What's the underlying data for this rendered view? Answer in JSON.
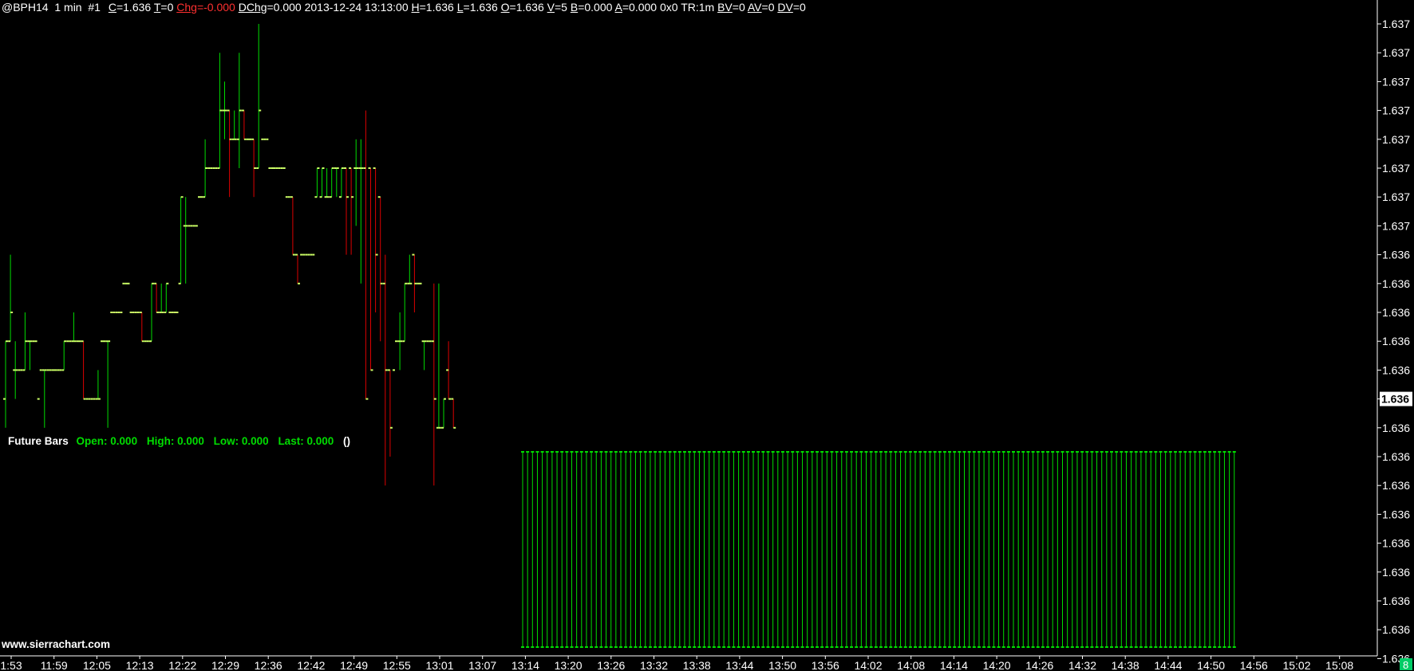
{
  "header": {
    "symbol": "@BPH14",
    "interval": "1 min",
    "chart_no": "#1",
    "fields": [
      {
        "key": "C",
        "value": "=1.636",
        "neg": false
      },
      {
        "key": "T",
        "value": "=0",
        "neg": false
      },
      {
        "key": "Chg",
        "value": "=-0.000",
        "neg": true
      },
      {
        "key": "DChg",
        "value": "=0.000",
        "neg": false
      }
    ],
    "datetime": "2013-12-24 13:13:00",
    "fields2": [
      {
        "key": "H",
        "value": "=1.636"
      },
      {
        "key": "L",
        "value": "=1.636"
      },
      {
        "key": "O",
        "value": "=1.636"
      },
      {
        "key": "V",
        "value": "=5"
      },
      {
        "key": "B",
        "value": "=0.000"
      },
      {
        "key": "A",
        "value": "=0.000"
      }
    ],
    "bidask_size": "0x0",
    "tr": "TR:1m",
    "fields3": [
      {
        "key": "BV",
        "value": "=0"
      },
      {
        "key": "AV",
        "value": "=0"
      },
      {
        "key": "DV",
        "value": "=0"
      }
    ]
  },
  "future_bars": {
    "label": "Future Bars",
    "open": "Open: 0.000",
    "high": "High: 0.000",
    "low": "Low: 0.000",
    "last": "Last: 0.000",
    "extra": "()"
  },
  "watermark": "www.sierrachart.com",
  "page_badge": "8",
  "colors": {
    "background": "#000000",
    "up": "#00dd00",
    "down": "#dd0000",
    "tick": "#ccff66",
    "axis_text": "#ffffff",
    "badge": "#00cc66"
  },
  "chart_data": {
    "type": "bar",
    "y_tick_labels": [
      "1.637",
      "1.637",
      "1.637",
      "1.637",
      "1.637",
      "1.637",
      "1.637",
      "1.637",
      "1.636",
      "1.636",
      "1.636",
      "1.636",
      "1.636",
      "1.636",
      "1.636",
      "1.636",
      "1.636",
      "1.636",
      "1.636",
      "1.636",
      "1.636",
      "1.636",
      "1.636"
    ],
    "current_price": "1.636",
    "x_tick_labels": [
      "1:53",
      "11:59",
      "12:05",
      "12:13",
      "12:22",
      "12:29",
      "12:36",
      "12:42",
      "12:49",
      "12:55",
      "13:01",
      "13:07",
      "13:14",
      "13:20",
      "13:26",
      "13:32",
      "13:38",
      "13:44",
      "13:50",
      "13:56",
      "14:02",
      "14:08",
      "14:14",
      "14:20",
      "14:26",
      "14:32",
      "14:38",
      "14:44",
      "14:50",
      "14:56",
      "15:02",
      "15:08"
    ],
    "price_levels_ticks": [
      26,
      25,
      24,
      23,
      22,
      21,
      20,
      19,
      18,
      17,
      16,
      15,
      14,
      13,
      12
    ],
    "bars": [
      {
        "o": 14,
        "h": 16,
        "l": 13,
        "c": 16
      },
      {
        "o": 16,
        "h": 19,
        "l": 16,
        "c": 17
      },
      {
        "o": 15,
        "h": 16,
        "l": 14,
        "c": 15
      },
      {
        "o": 15,
        "h": 15,
        "l": 15,
        "c": 15
      },
      {
        "o": 15,
        "h": 17,
        "l": 15,
        "c": 16
      },
      {
        "o": 16,
        "h": 16,
        "l": 15,
        "c": 16
      },
      {
        "o": 16,
        "h": 16,
        "l": 16,
        "c": 16
      },
      {
        "o": 14,
        "h": 14,
        "l": 14,
        "c": 15
      },
      {
        "o": 15,
        "h": 15,
        "l": 13,
        "c": 15
      },
      {
        "o": 15,
        "h": 15,
        "l": 15,
        "c": 15
      },
      {
        "o": 15,
        "h": 15,
        "l": 15,
        "c": 15
      },
      {
        "o": 15,
        "h": 15,
        "l": 15,
        "c": 15
      },
      {
        "o": 15,
        "h": 16,
        "l": 15,
        "c": 16
      },
      {
        "o": 16,
        "h": 16,
        "l": 16,
        "c": 16
      },
      {
        "o": 16,
        "h": 17,
        "l": 16,
        "c": 16
      },
      {
        "o": 16,
        "h": 16,
        "l": 16,
        "c": 16
      },
      {
        "o": 16,
        "h": 16,
        "l": 14,
        "c": 14
      },
      {
        "o": 14,
        "h": 14,
        "l": 14,
        "c": 14
      },
      {
        "o": 14,
        "h": 14,
        "l": 14,
        "c": 14
      },
      {
        "o": 14,
        "h": 15,
        "l": 14,
        "c": 14
      },
      {
        "o": 16,
        "h": 16,
        "l": 16,
        "c": 16
      },
      {
        "o": 16,
        "h": 16,
        "l": 13,
        "c": 16
      },
      {
        "o": 17,
        "h": 17,
        "l": 17,
        "c": 17
      },
      {
        "o": 17,
        "h": 17,
        "l": 17,
        "c": 17
      },
      {
        "o": 17,
        "h": 17,
        "l": 17,
        "c": 18
      },
      {
        "o": 18,
        "h": 18,
        "l": 18,
        "c": 18
      },
      {
        "o": 17,
        "h": 17,
        "l": 17,
        "c": 17
      },
      {
        "o": 17,
        "h": 17,
        "l": 17,
        "c": 17
      },
      {
        "o": 17,
        "h": 17,
        "l": 16,
        "c": 16
      },
      {
        "o": 16,
        "h": 16,
        "l": 16,
        "c": 16
      },
      {
        "o": 16,
        "h": 18,
        "l": 16,
        "c": 18
      },
      {
        "o": 18,
        "h": 18,
        "l": 17,
        "c": 17
      },
      {
        "o": 17,
        "h": 18,
        "l": 17,
        "c": 17
      },
      {
        "o": 17,
        "h": 18,
        "l": 17,
        "c": 18
      },
      {
        "o": 17,
        "h": 17,
        "l": 17,
        "c": 17
      },
      {
        "o": 17,
        "h": 17,
        "l": 17,
        "c": 17
      },
      {
        "o": 18,
        "h": 21,
        "l": 18,
        "c": 21
      },
      {
        "o": 20,
        "h": 21,
        "l": 18,
        "c": 20
      },
      {
        "o": 20,
        "h": 20,
        "l": 20,
        "c": 20
      },
      {
        "o": 20,
        "h": 20,
        "l": 20,
        "c": 20
      },
      {
        "o": 21,
        "h": 21,
        "l": 21,
        "c": 21
      },
      {
        "o": 21,
        "h": 23,
        "l": 21,
        "c": 22
      },
      {
        "o": 22,
        "h": 22,
        "l": 22,
        "c": 22
      },
      {
        "o": 22,
        "h": 22,
        "l": 22,
        "c": 22
      },
      {
        "o": 22,
        "h": 26,
        "l": 22,
        "c": 24
      },
      {
        "o": 24,
        "h": 25,
        "l": 23,
        "c": 24
      },
      {
        "o": 24,
        "h": 24,
        "l": 21,
        "c": 23
      },
      {
        "o": 23,
        "h": 24,
        "l": 23,
        "c": 23
      },
      {
        "o": 23,
        "h": 26,
        "l": 22,
        "c": 24
      },
      {
        "o": 24,
        "h": 24,
        "l": 23,
        "c": 23
      },
      {
        "o": 23,
        "h": 23,
        "l": 23,
        "c": 23
      },
      {
        "o": 23,
        "h": 23,
        "l": 21,
        "c": 22
      },
      {
        "o": 22,
        "h": 27,
        "l": 22,
        "c": 24
      },
      {
        "o": 23,
        "h": 23,
        "l": 23,
        "c": 23
      },
      {
        "o": 23,
        "h": 23,
        "l": 23,
        "c": 22
      },
      {
        "o": 22,
        "h": 22,
        "l": 22,
        "c": 22
      },
      {
        "o": 22,
        "h": 22,
        "l": 22,
        "c": 22
      },
      {
        "o": 22,
        "h": 22,
        "l": 22,
        "c": 22
      },
      {
        "o": 21,
        "h": 21,
        "l": 21,
        "c": 21
      },
      {
        "o": 21,
        "h": 21,
        "l": 19,
        "c": 19
      },
      {
        "o": 19,
        "h": 19,
        "l": 18,
        "c": 18
      },
      {
        "o": 19,
        "h": 19,
        "l": 19,
        "c": 19
      },
      {
        "o": 19,
        "h": 19,
        "l": 19,
        "c": 19
      },
      {
        "o": 19,
        "h": 19,
        "l": 19,
        "c": 19
      },
      {
        "o": 21,
        "h": 22,
        "l": 21,
        "c": 22
      },
      {
        "o": 21,
        "h": 22,
        "l": 21,
        "c": 22
      },
      {
        "o": 21,
        "h": 22,
        "l": 21,
        "c": 21
      },
      {
        "o": 21,
        "h": 22,
        "l": 21,
        "c": 22
      },
      {
        "o": 22,
        "h": 22,
        "l": 21,
        "c": 22
      },
      {
        "o": 21,
        "h": 22,
        "l": 21,
        "c": 22
      },
      {
        "o": 22,
        "h": 22,
        "l": 19,
        "c": 21
      },
      {
        "o": 22,
        "h": 22,
        "l": 19,
        "c": 21
      },
      {
        "o": 22,
        "h": 23,
        "l": 20,
        "c": 22
      },
      {
        "o": 22,
        "h": 23,
        "l": 18,
        "c": 22
      },
      {
        "o": 22,
        "h": 24,
        "l": 14,
        "c": 14
      },
      {
        "o": 22,
        "h": 22,
        "l": 15,
        "c": 15
      },
      {
        "o": 22,
        "h": 22,
        "l": 17,
        "c": 19
      },
      {
        "o": 21,
        "h": 21,
        "l": 16,
        "c": 18
      },
      {
        "o": 18,
        "h": 19,
        "l": 11,
        "c": 15
      },
      {
        "o": 15,
        "h": 15,
        "l": 12,
        "c": 13
      },
      {
        "o": 15,
        "h": 15,
        "l": 15,
        "c": 16
      },
      {
        "o": 16,
        "h": 17,
        "l": 15,
        "c": 16
      },
      {
        "o": 16,
        "h": 18,
        "l": 16,
        "c": 18
      },
      {
        "o": 18,
        "h": 19,
        "l": 18,
        "c": 18
      },
      {
        "o": 19,
        "h": 19,
        "l": 17,
        "c": 18
      },
      {
        "o": 18,
        "h": 18,
        "l": 18,
        "c": 18
      },
      {
        "o": 16,
        "h": 16,
        "l": 15,
        "c": 16
      },
      {
        "o": 16,
        "h": 16,
        "l": 16,
        "c": 16
      },
      {
        "o": 16,
        "h": 18,
        "l": 11,
        "c": 14
      },
      {
        "o": 13,
        "h": 18,
        "l": 13,
        "c": 13
      },
      {
        "o": 13,
        "h": 14,
        "l": 13,
        "c": 14
      },
      {
        "o": 15,
        "h": 16,
        "l": 14,
        "c": 14
      },
      {
        "o": 14,
        "h": 14,
        "l": 13,
        "c": 13
      }
    ]
  }
}
